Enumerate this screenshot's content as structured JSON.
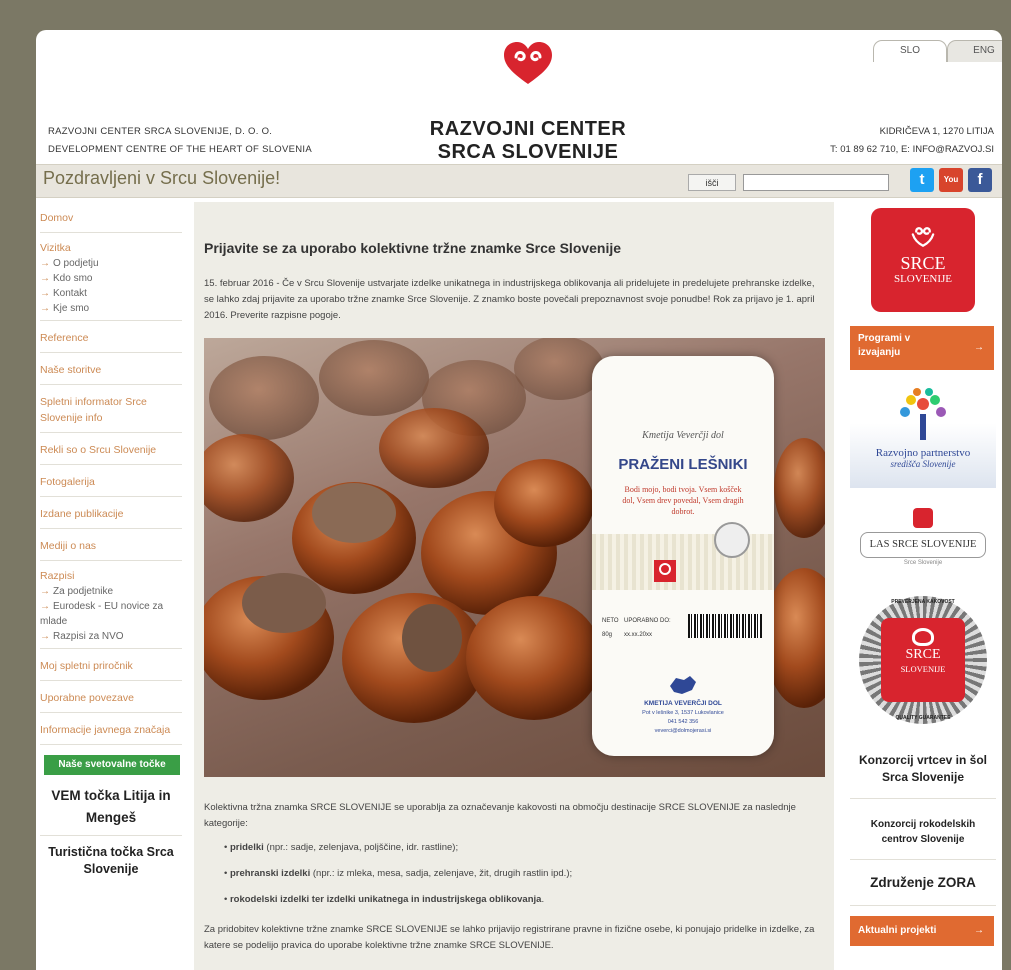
{
  "lang": {
    "slo": "SLO",
    "eng": "ENG"
  },
  "header": {
    "left_line1": "RAZVOJNI CENTER SRCA SLOVENIJE, D. O. O.",
    "left_line2": "DEVELOPMENT CENTRE OF THE HEART OF SLOVENIA",
    "logo_line1": "RAZVOJNI CENTER",
    "logo_line2": "SRCA SLOVENIJE",
    "right_line1": "KIDRIČEVA 1, 1270 LITIJA",
    "right_line2": "T: 01 89 62 710, E: INFO@RAZVOJ.SI"
  },
  "bar": {
    "greeting": "Pozdravljeni v Srcu Slovenije!",
    "search_button": "išči",
    "search_value": ""
  },
  "nav": {
    "domov": "Domov",
    "vizitka": "Vizitka",
    "vizitka_sub": [
      "O podjetju",
      "Kdo smo",
      "Kontakt",
      "Kje smo"
    ],
    "reference": "Reference",
    "storitve": "Naše storitve",
    "informator": "Spletni informator Srce Slovenije info",
    "rekli": "Rekli so o Srcu Slovenije",
    "fotogalerija": "Fotogalerija",
    "publikacije": "Izdane publikacije",
    "mediji": "Mediji o nas",
    "razpisi": "Razpisi",
    "razpisi_sub": [
      "Za podjetnike",
      "Eurodesk - EU novice za mlade",
      "Razpisi za NVO"
    ],
    "prirocnik": "Moj spletni priročnik",
    "povezave": "Uporabne povezave",
    "informacije": "Informacije javnega značaja",
    "svetovalne": "Naše svetovalne točke",
    "vem": "VEM točka Litija in Mengeš",
    "turisticna": "Turistična točka Srca Slovenije"
  },
  "article": {
    "title": "Prijavite se za uporabo kolektivne tržne znamke Srce Slovenije",
    "intro": "15. februar 2016 - Če v Srcu Slovenije ustvarjate izdelke unikatnega in industrijskega oblikovanja ali pridelujete in predelujete prehranske izdelke, se lahko zdaj prijavite za uporabo tržne znamke Srce Slovenije. Z znamko boste povečali prepoznavnost svoje ponudbe! Rok za prijavo je 1. april 2016. Preverite razpisne pogoje.",
    "package_maker": "Kmetija Veverčji dol",
    "package_name": "PRAŽENI LEŠNIKI",
    "package_slogan": "Bodi mojo, bodi tvoja. Vsem košček dol, Vsem drev povedal, Vsem dragih dobrot.",
    "package_footer1": "KMETIJA VEVERČJI DOL",
    "package_footer2": "Pot v lešnike 3, 1537 Lukovlanice",
    "package_footer3": "041 542 356",
    "package_footer4": "veverci@dolmojerasi.si",
    "package_neto": "NETO",
    "package_neto_val": "80g",
    "package_upor": "UPORABNO DO:",
    "package_upor_val": "xx.xx.20xx",
    "paragraph1": "Kolektivna tržna znamka SRCE SLOVENIJE se uporablja za označevanje kakovosti na območju destinacije SRCE SLOVENIJE za naslednje kategorije:",
    "bullets": [
      {
        "bold": "pridelki",
        "rest": " (npr.: sadje, zelenjava, poljščine, idr. rastline);"
      },
      {
        "bold": "prehranski izdelki",
        "rest": " (npr.: iz mleka, mesa, sadja, zelenjave, žit, drugih rastlin ipd.);"
      },
      {
        "bold": "rokodelski izdelki ter izdelki unikatnega in industrijskega oblikovanja",
        "rest": "."
      }
    ],
    "paragraph2": "Za pridobitev kolektivne tržne znamke SRCE SLOVENIJE se lahko prijavijo registrirane pravne in fizične osebe, ki ponujajo pridelke in izdelke, za katere se podelijo pravica do uporabe kolektivne tržne znamke SRCE SLOVENIJE."
  },
  "right": {
    "srce_logo_line1": "SRCE",
    "srce_logo_line2": "SLOVENIJE",
    "programi": "Programi v izvajanju",
    "partnerstvo_line1": "Razvojno partnerstvo",
    "partnerstvo_line2": "središča Slovenije",
    "las": "LAS SRCE SLOVENIJE",
    "las_sub": "Srce Slovenije",
    "seal_top": "PREVERJENA KAKOVOST",
    "seal_bottom": "QUALITY GUARANTEE",
    "seal_line1": "SRCE",
    "seal_line2": "SLOVENIJE",
    "konzorcij_vrtcev": "Konzorcij vrtcev in šol Srca Slovenije",
    "konzorcij_rokodelskih": "Konzorcij rokodelskih centrov Slovenije",
    "zora": "Združenje ZORA",
    "aktualni": "Aktualni projekti"
  },
  "colors": {
    "accent": "#e06a31",
    "nav_link": "#cc8a54",
    "brand_red": "#d8242e",
    "green": "#3a9e46"
  },
  "icons": {
    "twitter": "twitter-icon",
    "youtube": "youtube-icon",
    "facebook": "facebook-icon",
    "arrow": "arrow-right-icon"
  }
}
